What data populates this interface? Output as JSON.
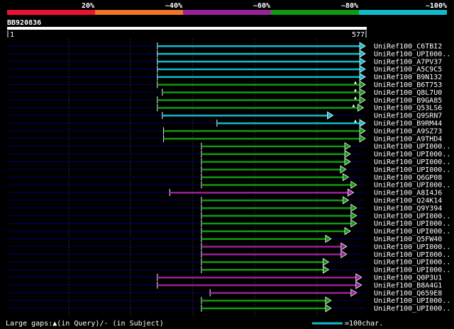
{
  "colors": {
    "background": "#000000",
    "guide_line": "#000066",
    "grid_line": "#444444",
    "query_bar": "#ffffff",
    "bin_colors": [
      "#ee1133",
      "#ee7722",
      "#992299",
      "#119911",
      "#11bbcc"
    ]
  },
  "legend": {
    "labels": [
      "20%",
      "~40%",
      "~60%",
      "~80%",
      "~100%"
    ]
  },
  "query": {
    "name": "BB920836",
    "start_label": "1",
    "end_label": "577",
    "length": 577
  },
  "footer": {
    "gaps_text": "Large gaps:▲(in Query)/- (in Subject)",
    "scale_text": "=100char.",
    "scale_value": 100
  },
  "chart_data": {
    "type": "alignment",
    "rows": [
      {
        "name": "UniRef100_C6TBI2",
        "start": 242,
        "end": 577,
        "bin": 4
      },
      {
        "name": "UniRef100_UPI000..",
        "start": 242,
        "end": 577,
        "bin": 4
      },
      {
        "name": "UniRef100_A7PV37",
        "start": 242,
        "end": 577,
        "bin": 4
      },
      {
        "name": "UniRef100_A5C9C5",
        "start": 242,
        "end": 577,
        "bin": 4
      },
      {
        "name": "UniRef100_B9N132",
        "start": 242,
        "end": 577,
        "bin": 4
      },
      {
        "name": "UniRef100_B6T753",
        "start": 242,
        "end": 577,
        "bin": 3,
        "gap": true
      },
      {
        "name": "UniRef100_Q8L7U0",
        "start": 250,
        "end": 577,
        "bin": 3,
        "gap": true
      },
      {
        "name": "UniRef100_B9GA85",
        "start": 242,
        "end": 577,
        "bin": 3,
        "gap": true
      },
      {
        "name": "UniRef100_Q53LS6",
        "start": 242,
        "end": 574,
        "bin": 3,
        "gap": true
      },
      {
        "name": "UniRef100_Q9SRN7",
        "start": 250,
        "end": 525,
        "bin": 4
      },
      {
        "name": "UniRef100_B9RM44",
        "start": 338,
        "end": 577,
        "bin": 4,
        "gap": true
      },
      {
        "name": "UniRef100_A9SZ73",
        "start": 252,
        "end": 577,
        "bin": 3
      },
      {
        "name": "UniRef100_A9THD4",
        "start": 252,
        "end": 577,
        "bin": 3
      },
      {
        "name": "UniRef100_UPI000..",
        "start": 313,
        "end": 553,
        "bin": 3
      },
      {
        "name": "UniRef100_UPI000..",
        "start": 313,
        "end": 553,
        "bin": 3
      },
      {
        "name": "UniRef100_UPI000..",
        "start": 313,
        "end": 553,
        "bin": 3
      },
      {
        "name": "UniRef100_UPI000..",
        "start": 313,
        "end": 546,
        "bin": 3
      },
      {
        "name": "UniRef100_Q6GP08",
        "start": 313,
        "end": 550,
        "bin": 3
      },
      {
        "name": "UniRef100_UPI000..",
        "start": 313,
        "end": 563,
        "bin": 3
      },
      {
        "name": "UniRef100_A8I4J6",
        "start": 262,
        "end": 558,
        "bin": 2
      },
      {
        "name": "UniRef100_Q24K14",
        "start": 313,
        "end": 550,
        "bin": 3
      },
      {
        "name": "UniRef100_Q9Y394",
        "start": 313,
        "end": 563,
        "bin": 3
      },
      {
        "name": "UniRef100_UPI000..",
        "start": 313,
        "end": 563,
        "bin": 3
      },
      {
        "name": "UniRef100_UPI000..",
        "start": 313,
        "end": 563,
        "bin": 3
      },
      {
        "name": "UniRef100_UPI000..",
        "start": 313,
        "end": 553,
        "bin": 3
      },
      {
        "name": "UniRef100_Q5FW40",
        "start": 313,
        "end": 522,
        "bin": 3
      },
      {
        "name": "UniRef100_UPI000..",
        "start": 313,
        "end": 547,
        "bin": 2
      },
      {
        "name": "UniRef100_UPI000..",
        "start": 313,
        "end": 547,
        "bin": 2
      },
      {
        "name": "UniRef100_UPI000..",
        "start": 313,
        "end": 518,
        "bin": 3
      },
      {
        "name": "UniRef100_UPI000..",
        "start": 313,
        "end": 518,
        "bin": 3
      },
      {
        "name": "UniRef100_Q0P3U1",
        "start": 242,
        "end": 571,
        "bin": 2
      },
      {
        "name": "UniRef100_B8A4G1",
        "start": 242,
        "end": 571,
        "bin": 2
      },
      {
        "name": "UniRef100_Q659E8",
        "start": 327,
        "end": 563,
        "bin": 2
      },
      {
        "name": "UniRef100_UPI000..",
        "start": 313,
        "end": 522,
        "bin": 3
      },
      {
        "name": "UniRef100_UPI000..",
        "start": 313,
        "end": 522,
        "bin": 3
      }
    ]
  }
}
